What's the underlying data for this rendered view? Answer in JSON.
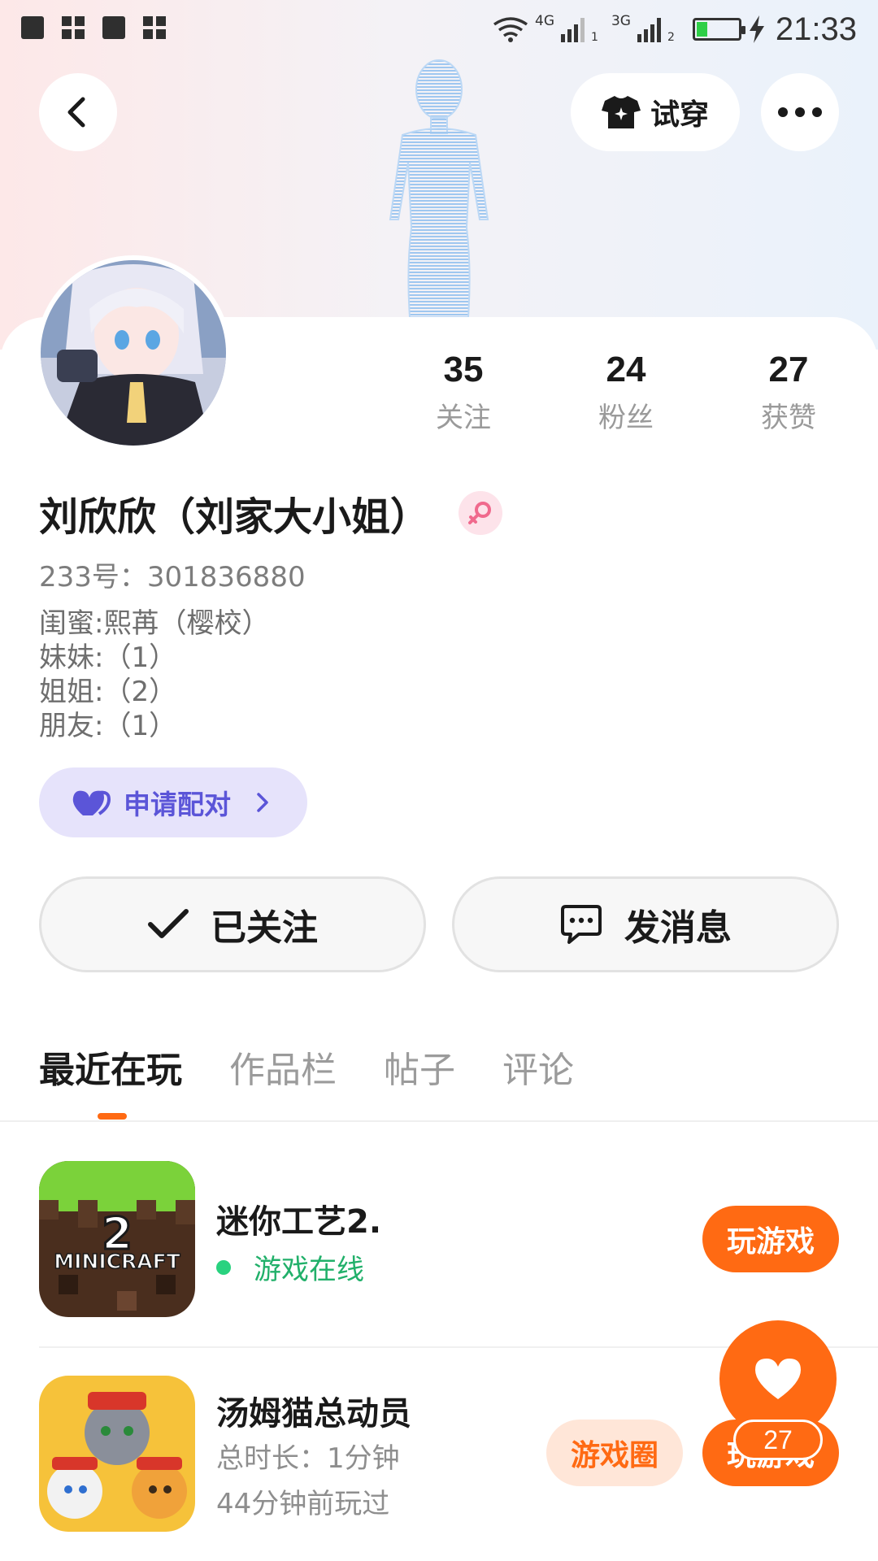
{
  "status_bar": {
    "network_1": "4G",
    "sim_1": "1",
    "network_2": "3G",
    "sim_2": "2",
    "battery_level": 0.25,
    "time": "21:33"
  },
  "header": {
    "try_on_label": "试穿",
    "icons": [
      "back-icon",
      "shirt-icon",
      "more-icon"
    ]
  },
  "profile": {
    "stats": [
      {
        "value": "35",
        "label": "关注"
      },
      {
        "value": "24",
        "label": "粉丝"
      },
      {
        "value": "27",
        "label": "获赞"
      }
    ],
    "name": "刘欣欣（刘家大小姐）",
    "gender": "female",
    "uid": "233号：301836880",
    "bio_lines": [
      "闺蜜:熙苒（樱校）",
      "妹妹:（1）",
      "姐姐:（2）",
      "朋友:（1）"
    ],
    "pair_label": "申请配对",
    "follow_label": "已关注",
    "message_label": "发消息"
  },
  "tabs": [
    {
      "label": "最近在玩",
      "active": true
    },
    {
      "label": "作品栏",
      "active": false
    },
    {
      "label": "帖子",
      "active": false
    },
    {
      "label": "评论",
      "active": false
    }
  ],
  "games": [
    {
      "title": "迷你工艺2.",
      "status": "游戏在线",
      "icon_text": "MINICRAFT",
      "icon_number": "2",
      "play_label": "玩游戏"
    },
    {
      "title": "汤姆猫总动员",
      "duration": "总时长：1分钟",
      "last_played": "44分钟前玩过",
      "circle_label": "游戏圈",
      "play_label": "玩游戏"
    }
  ],
  "like_fab": {
    "count": "27"
  },
  "colors": {
    "accent": "#ff6a13",
    "pair_bg": "#e6e3fb",
    "pair_text": "#5b55d8",
    "online": "#21b06a"
  }
}
